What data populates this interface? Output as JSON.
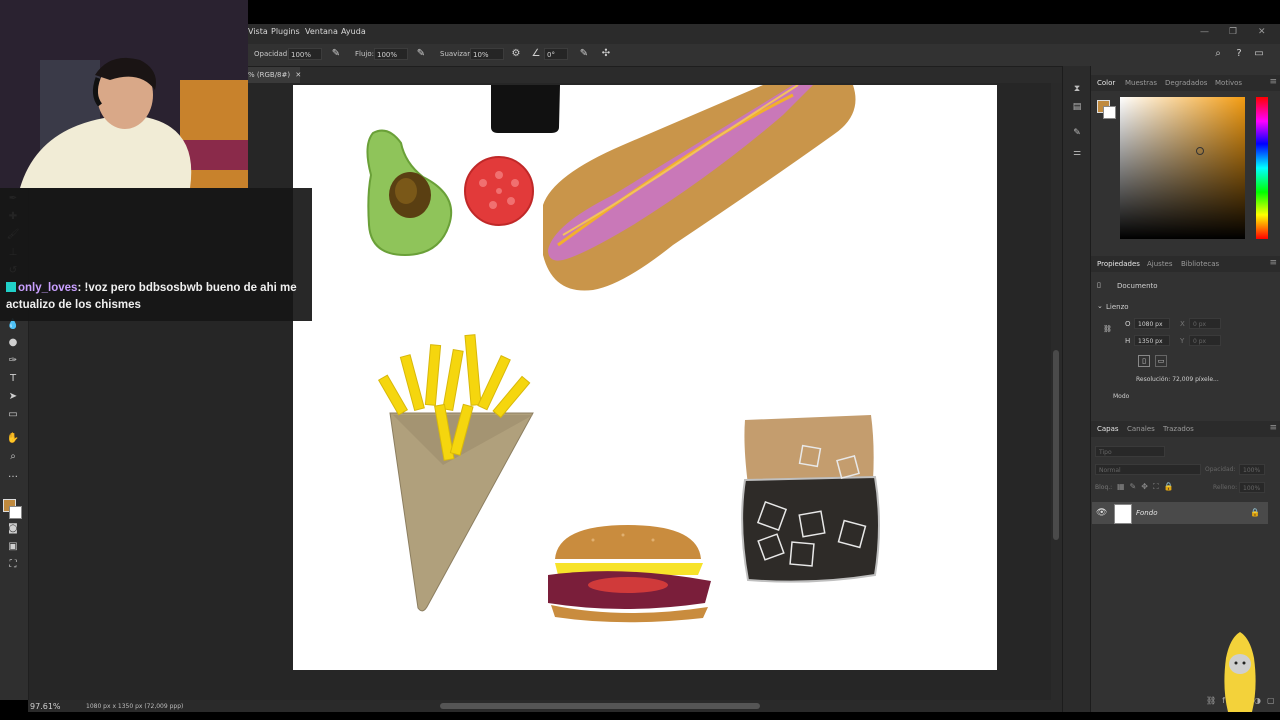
{
  "menubar": {
    "items": [
      "Vista",
      "Plugins",
      "Ventana",
      "Ayuda"
    ]
  },
  "options": {
    "opacity_label": "Opacidad:",
    "opacity_value": "100%",
    "flow_label": "Flujo:",
    "flow_value": "100%",
    "smoothing_label": "Suavizar:",
    "smoothing_value": "10%",
    "angle_value": "0°"
  },
  "document": {
    "tab_label": "% (RGB/8#)",
    "zoom": "97.61%",
    "info": "1080 px x 1350 px (72,009 ppp)"
  },
  "color_panel": {
    "tabs": [
      "Color",
      "Muestras",
      "Degradados",
      "Motivos"
    ],
    "foreground": "#c08a3e",
    "background": "#ffffff"
  },
  "properties_panel": {
    "tabs": [
      "Propiedades",
      "Ajustes",
      "Bibliotecas"
    ],
    "doc_label": "Documento",
    "section": "Lienzo",
    "w_label": "O",
    "w_value": "1080 px",
    "h_label": "H",
    "h_value": "1350 px",
    "x_label": "X",
    "x_value": "0 px",
    "y_label": "Y",
    "y_value": "0 px",
    "resolution": "Resolución: 72,009 píxele...",
    "mode_label": "Modo"
  },
  "layers_panel": {
    "tabs": [
      "Capas",
      "Canales",
      "Trazados"
    ],
    "search_placeholder": "Tipo",
    "blend_mode": "Normal",
    "opacity_label": "Opacidad:",
    "opacity_value": "100%",
    "lock_label": "Bloq.:",
    "fill_label": "Relleno:",
    "fill_value": "100%",
    "layer_name": "Fondo"
  },
  "chat": {
    "username": "only_loves",
    "message": "!voz pero bdbsosbwb bueno de ahi me actualizo de los chismes"
  }
}
